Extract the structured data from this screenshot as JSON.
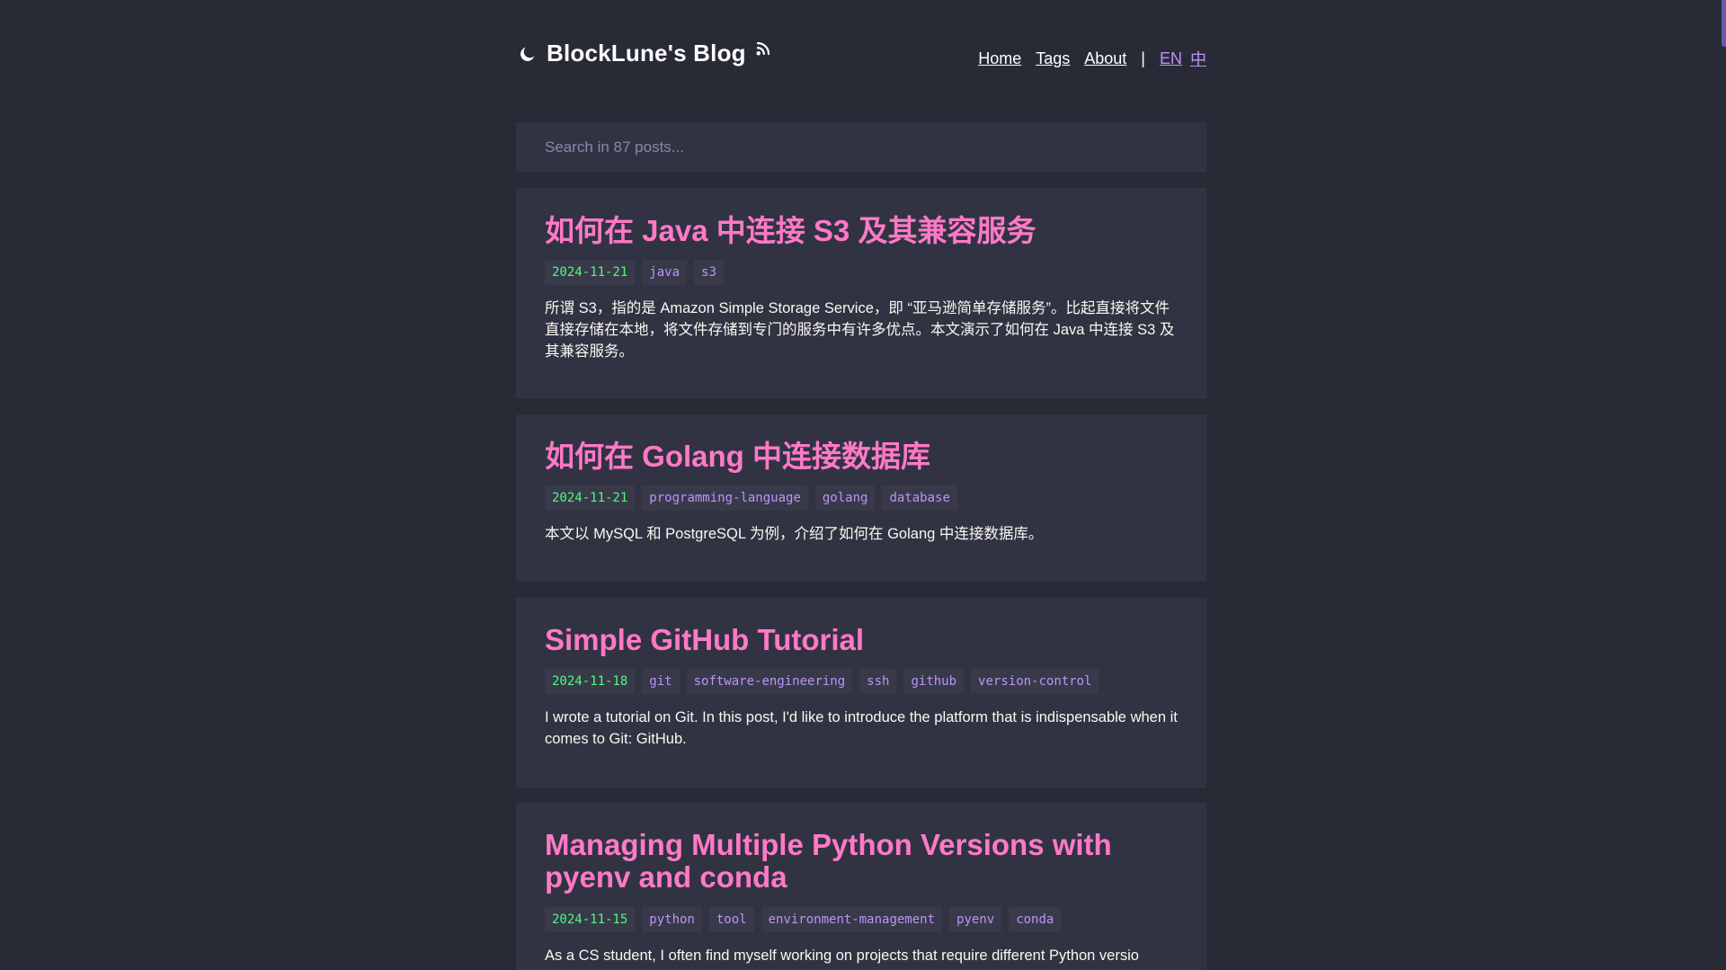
{
  "header": {
    "site_title": "BlockLune's Blog",
    "nav": {
      "home": "Home",
      "tags": "Tags",
      "about": "About",
      "separator": "|",
      "lang_en": "EN",
      "lang_zh": "中"
    }
  },
  "search": {
    "placeholder": "Search in 87 posts..."
  },
  "posts": [
    {
      "title": "如何在 Java 中连接 S3 及其兼容服务",
      "date": "2024-11-21",
      "tags": [
        "java",
        "s3"
      ],
      "excerpt": "所谓 S3，指的是 Amazon Simple Storage Service，即 “亚马逊简单存储服务”。比起直接将文件直接存储在本地，将文件存储到专门的服务中有许多优点。本文演示了如何在 Java 中连接 S3 及其兼容服务。"
    },
    {
      "title": "如何在 Golang 中连接数据库",
      "date": "2024-11-21",
      "tags": [
        "programming-language",
        "golang",
        "database"
      ],
      "excerpt": "本文以 MySQL 和 PostgreSQL 为例，介绍了如何在 Golang 中连接数据库。"
    },
    {
      "title": "Simple GitHub Tutorial",
      "date": "2024-11-18",
      "tags": [
        "git",
        "software-engineering",
        "ssh",
        "github",
        "version-control"
      ],
      "excerpt": "I wrote a tutorial on Git. In this post, I'd like to introduce the platform that is indispensable when it comes to Git: GitHub."
    },
    {
      "title": "Managing Multiple Python Versions with pyenv and conda",
      "date": "2024-11-15",
      "tags": [
        "python",
        "tool",
        "environment-management",
        "pyenv",
        "conda"
      ],
      "excerpt": "As a CS student, I often find myself working on projects that require different Python versio"
    }
  ],
  "colors": {
    "background": "#282a36",
    "card": "#313342",
    "title": "#ff79c6",
    "date": "#50fa7b",
    "tag": "#bd93f9",
    "accent": "#6e59a5"
  }
}
